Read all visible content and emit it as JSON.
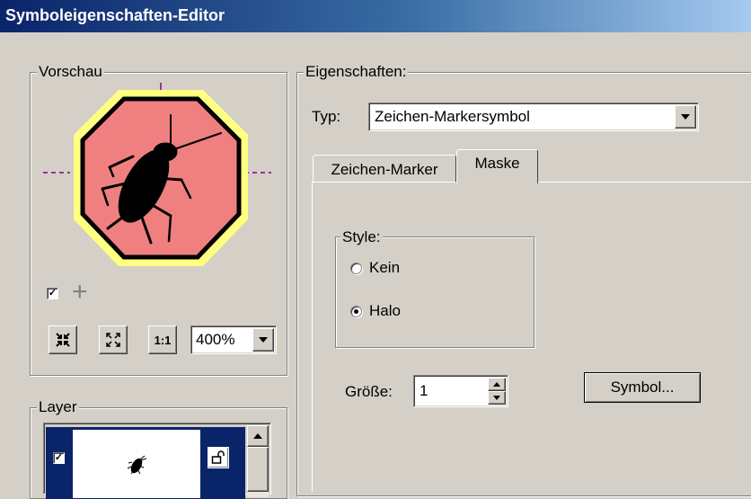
{
  "window": {
    "title": "Symboleigenschaften-Editor"
  },
  "preview": {
    "group_label": "Vorschau",
    "zoom_value": "400%",
    "show_crosshair_checked": true
  },
  "properties": {
    "group_label": "Eigenschaften:",
    "type_label": "Typ:",
    "type_value": "Zeichen-Markersymbol",
    "tabs": [
      {
        "label": "Zeichen-Marker",
        "active": false
      },
      {
        "label": "Maske",
        "active": true
      }
    ],
    "mask": {
      "style_group_label": "Style:",
      "options": [
        {
          "label": "Kein",
          "selected": false
        },
        {
          "label": "Halo",
          "selected": true
        }
      ],
      "size_label": "Größe:",
      "size_value": "1",
      "symbol_button": "Symbol..."
    }
  },
  "layers": {
    "group_label": "Layer",
    "items": [
      {
        "checked": true,
        "locked": true
      }
    ]
  },
  "colors": {
    "titlebar_start": "#0a246a",
    "titlebar_end": "#a6caf0",
    "halo": "#ffff80",
    "marker_fill": "#f08080",
    "layer_selection": "#0a246a"
  },
  "icons": {
    "zoom_in": "shrink-arrows-icon",
    "zoom_out": "expand-arrows-icon",
    "actual_size": "one-to-one-icon",
    "crosshair": "plus-icon",
    "lock": "lock-icon",
    "dropdown": "triangle-down-icon",
    "preview_symbol": "beetle-icon"
  }
}
